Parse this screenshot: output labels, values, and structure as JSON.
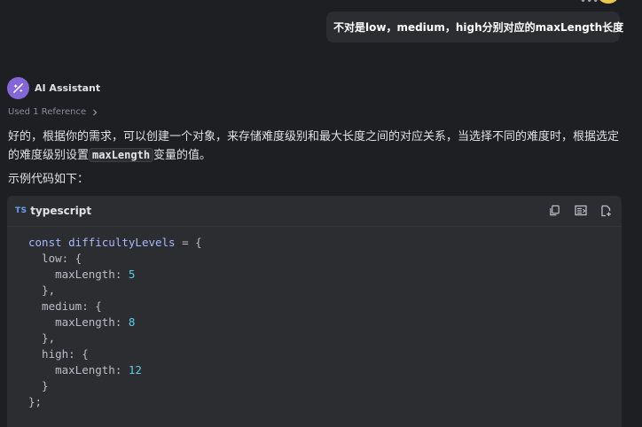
{
  "user_message": {
    "text": "不对是low，medium，high分别对应的maxLength长度"
  },
  "assistant": {
    "name": "AI Assistant",
    "references": "Used 1 Reference",
    "paragraph1_before": "好的，根据你的需求，可以创建一个对象，来存储难度级别和最大长度之间的对应关系，当选择不同的难度时，根据选定的难度级别设置",
    "paragraph1_code": "maxLength",
    "paragraph1_after": "变量的值。",
    "paragraph2": "示例代码如下："
  },
  "code_block": {
    "badge": "TS",
    "language": "typescript",
    "actions": [
      "copy-icon",
      "insert-icon",
      "new-file-icon"
    ],
    "lines": [
      {
        "parts": [
          {
            "t": "const ",
            "c": "kw"
          },
          {
            "t": "difficultyLevels",
            "c": "var"
          },
          {
            "t": " = {",
            "c": ""
          }
        ]
      },
      {
        "parts": [
          {
            "t": "  low: {",
            "c": ""
          }
        ]
      },
      {
        "parts": [
          {
            "t": "    maxLength: ",
            "c": ""
          },
          {
            "t": "5",
            "c": "num"
          }
        ]
      },
      {
        "parts": [
          {
            "t": "  },",
            "c": ""
          }
        ]
      },
      {
        "parts": [
          {
            "t": "  medium: {",
            "c": ""
          }
        ]
      },
      {
        "parts": [
          {
            "t": "    maxLength: ",
            "c": ""
          },
          {
            "t": "8",
            "c": "num"
          }
        ]
      },
      {
        "parts": [
          {
            "t": "  },",
            "c": ""
          }
        ]
      },
      {
        "parts": [
          {
            "t": "  high: {",
            "c": ""
          }
        ]
      },
      {
        "parts": [
          {
            "t": "    maxLength: ",
            "c": ""
          },
          {
            "t": "12",
            "c": "num"
          }
        ]
      },
      {
        "parts": [
          {
            "t": "  }",
            "c": ""
          }
        ]
      },
      {
        "parts": [
          {
            "t": "};",
            "c": ""
          }
        ]
      }
    ]
  },
  "colors": {
    "background": "#1e1f22",
    "bubble": "#2b2d30",
    "avatar_accent": "#8566d6",
    "keyword": "#a9b7ff",
    "number": "#5ccfe6",
    "ts_badge": "#6aa0f0"
  }
}
